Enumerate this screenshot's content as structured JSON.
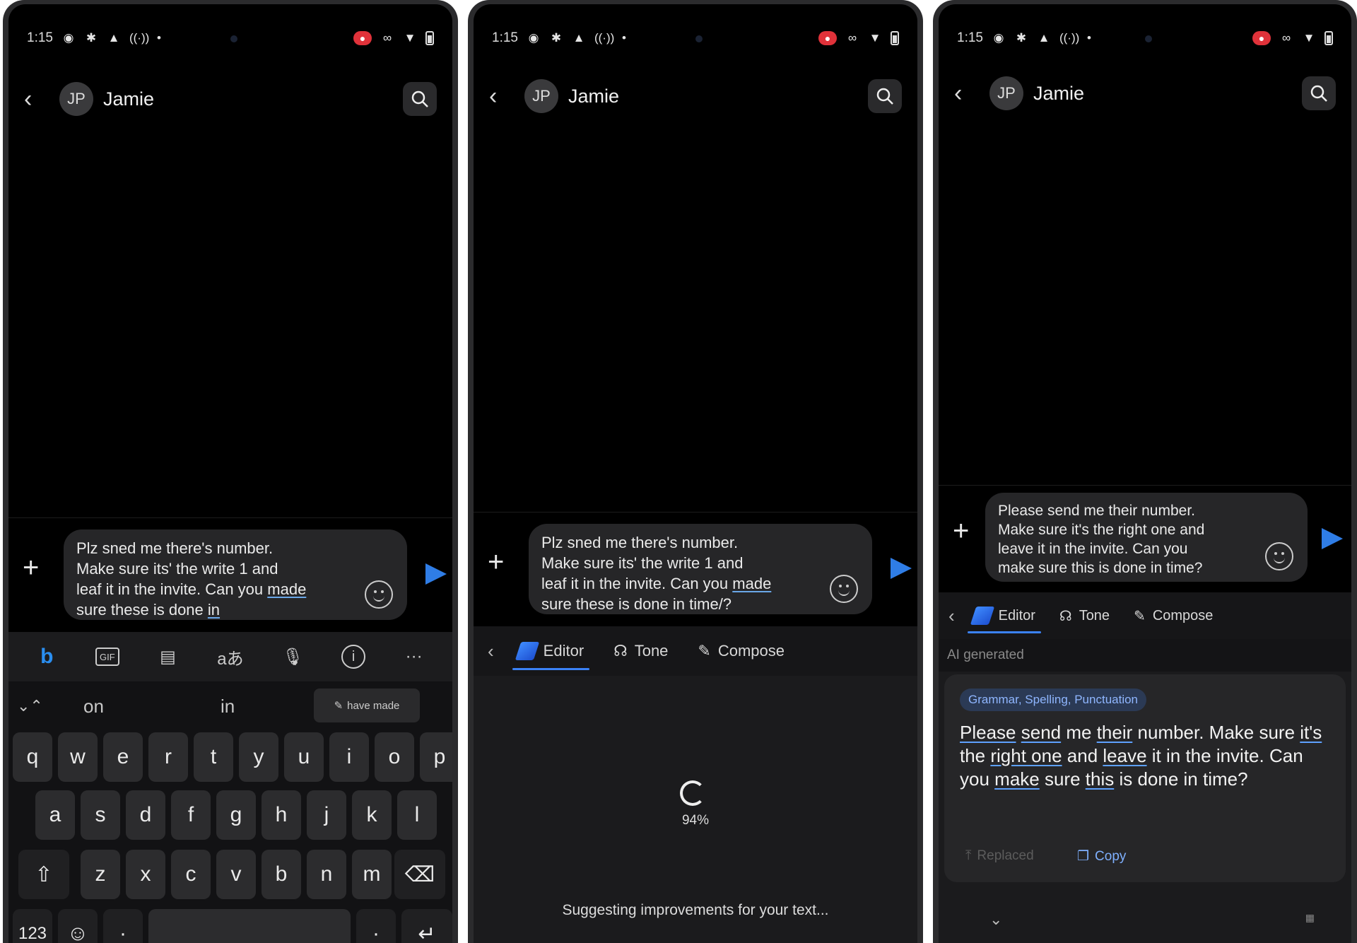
{
  "status": {
    "time": "1:15"
  },
  "conversation": {
    "initials": "JP",
    "name": "Jamie"
  },
  "phone1": {
    "draft_lines": [
      "Plz sned me there's number.",
      "Make sure its' the write 1 and",
      "leaf it in the invite. Can you ",
      "made",
      "sure these is done ",
      "in"
    ],
    "toolbar": {
      "gif": "GIF",
      "translate": "aあ",
      "more": "···"
    },
    "suggestions": {
      "first": "on",
      "second": "in",
      "chip": "have made"
    },
    "keys_row1": [
      "q",
      "w",
      "e",
      "r",
      "t",
      "y",
      "u",
      "i",
      "o",
      "p"
    ],
    "keys_row2": [
      "a",
      "s",
      "d",
      "f",
      "g",
      "h",
      "j",
      "k",
      "l"
    ],
    "keys_row3": [
      "z",
      "x",
      "c",
      "v",
      "b",
      "n",
      "m"
    ],
    "num_key": "123"
  },
  "phone2": {
    "draft_lines": [
      "Plz sned me there's number.",
      "Make sure its' the write 1 and",
      "leaf it in the invite. Can you ",
      "made",
      "sure these is done in time/?"
    ],
    "tabs": {
      "editor": "Editor",
      "tone": "Tone",
      "compose": "Compose"
    },
    "progress_percent": 94,
    "progress_label": "94%",
    "status_text": "Suggesting improvements for your text..."
  },
  "phone3": {
    "draft_lines": [
      "Please send me their number.",
      "Make sure it's the right one and",
      "leave it in the invite. Can you",
      "make sure this is done in time?"
    ],
    "tabs": {
      "editor": "Editor",
      "tone": "Tone",
      "compose": "Compose"
    },
    "ai_label": "AI generated",
    "chip": "Grammar, Spelling, Punctuation",
    "result_text": "Please send me their number. Make sure it's the right one and leave it in the invite. Can you make sure this is done in time?",
    "replaced": "Replaced",
    "copy": "Copy"
  },
  "colors": {
    "accent": "#2f7de6",
    "chip_bg": "#2b3a55",
    "background": "#000000"
  }
}
